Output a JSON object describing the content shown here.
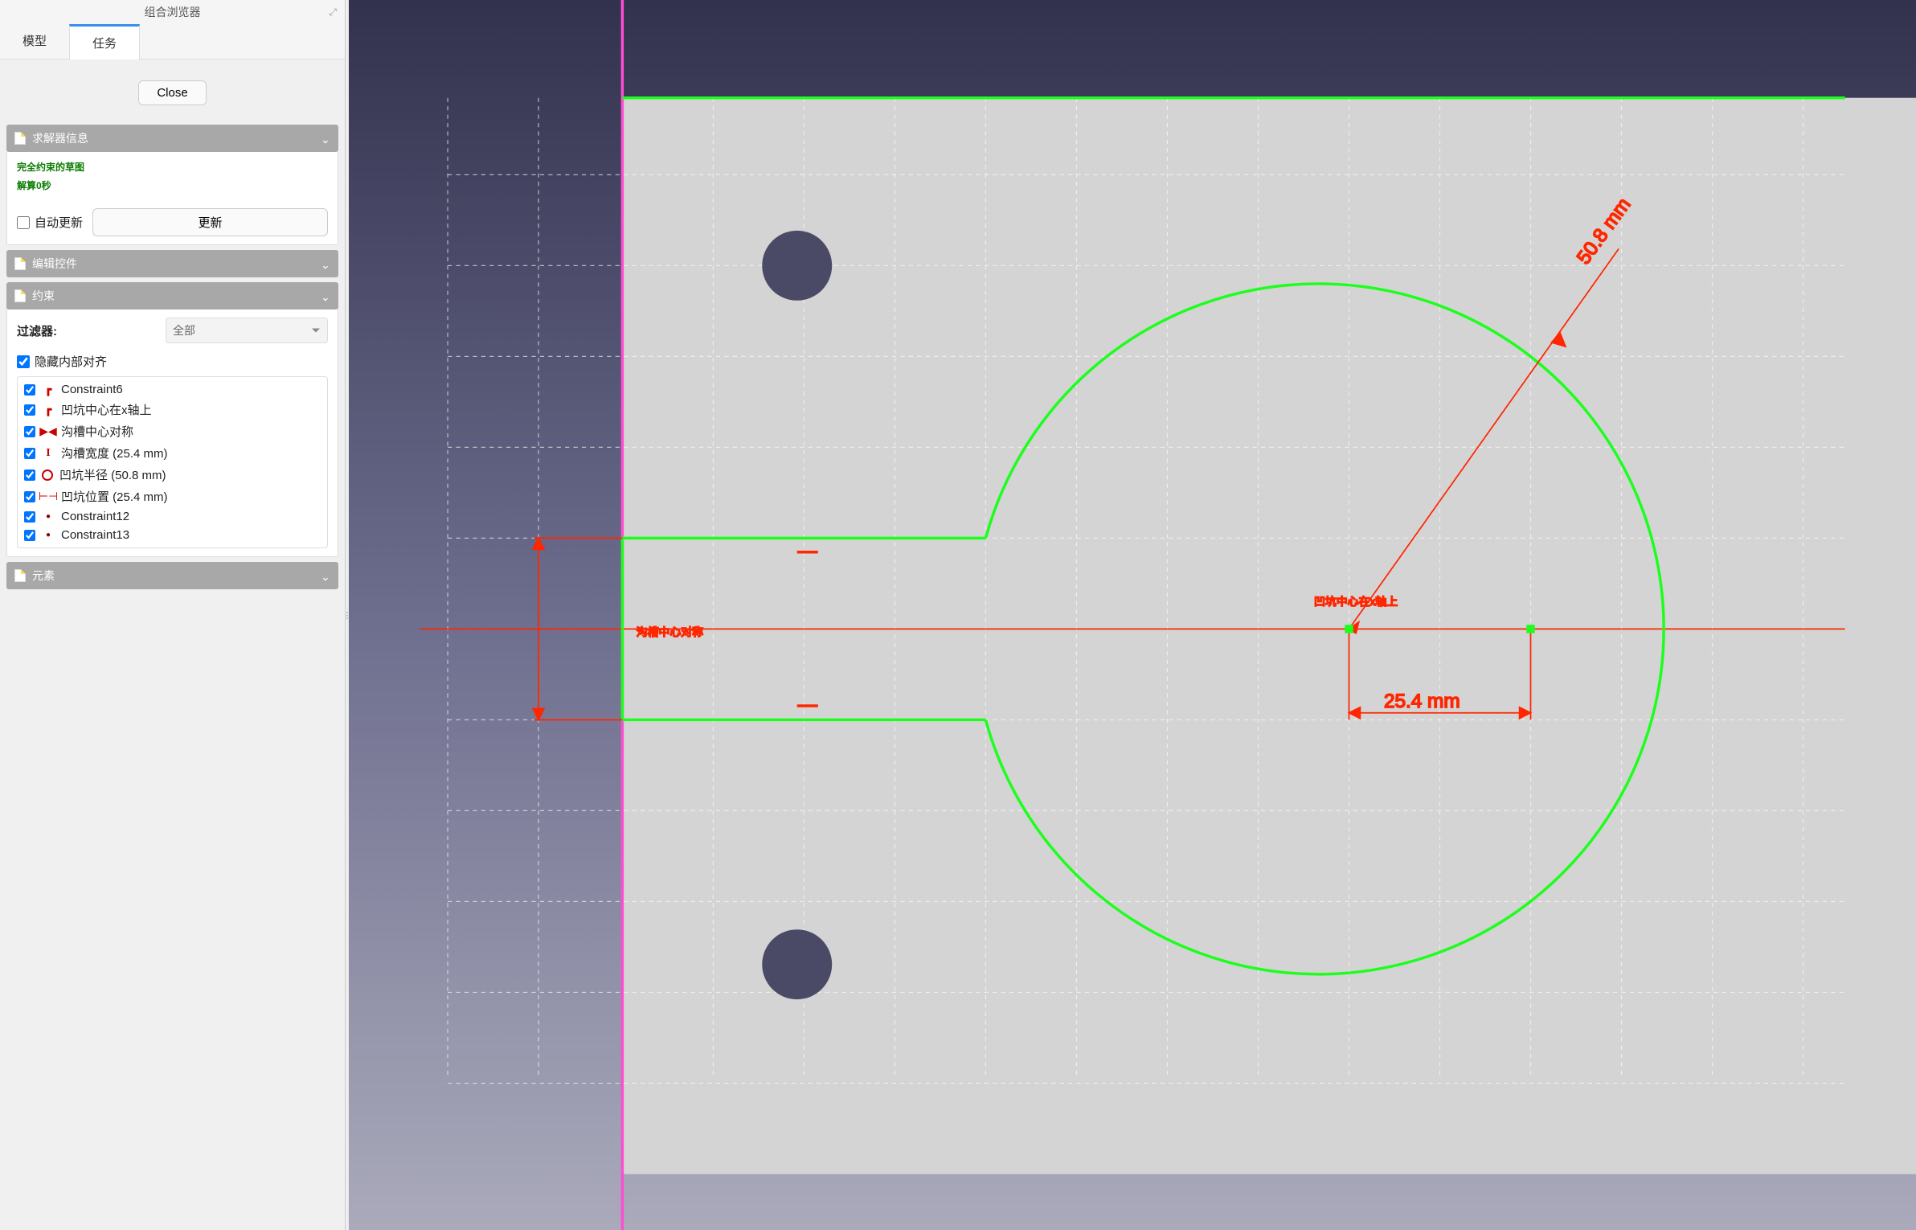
{
  "panel": {
    "title": "组合浏览器",
    "tabs": {
      "model": "模型",
      "tasks": "任务"
    },
    "closeBtn": "Close"
  },
  "solver": {
    "header": "求解器信息",
    "line1": "完全约束的草图",
    "line2": "解算0秒",
    "autoUpdate": "自动更新",
    "updateBtn": "更新"
  },
  "editControls": {
    "header": "编辑控件"
  },
  "constraints": {
    "header": "约束",
    "filterLabel": "过滤器:",
    "filterValue": "全部",
    "hideInternal": "隐藏内部对齐",
    "items": [
      {
        "icon": "tangent",
        "label": "Constraint6"
      },
      {
        "icon": "tangent",
        "label": "凹坑中心在x轴上"
      },
      {
        "icon": "sym",
        "label": "沟槽中心对称"
      },
      {
        "icon": "distV",
        "label": "沟槽宽度 (25.4 mm)"
      },
      {
        "icon": "radius",
        "label": "凹坑半径 (50.8 mm)"
      },
      {
        "icon": "distH",
        "label": "凹坑位置 (25.4 mm)"
      },
      {
        "icon": "dot",
        "label": "Constraint12"
      },
      {
        "icon": "dot",
        "label": "Constraint13"
      }
    ]
  },
  "elements": {
    "header": "元素"
  },
  "canvas": {
    "dims": {
      "radius": "50.8 mm",
      "distH": "25.4 mm",
      "centerLabel": "凹坑中心在x轴上",
      "slotLabel": "沟槽中心对称"
    }
  }
}
